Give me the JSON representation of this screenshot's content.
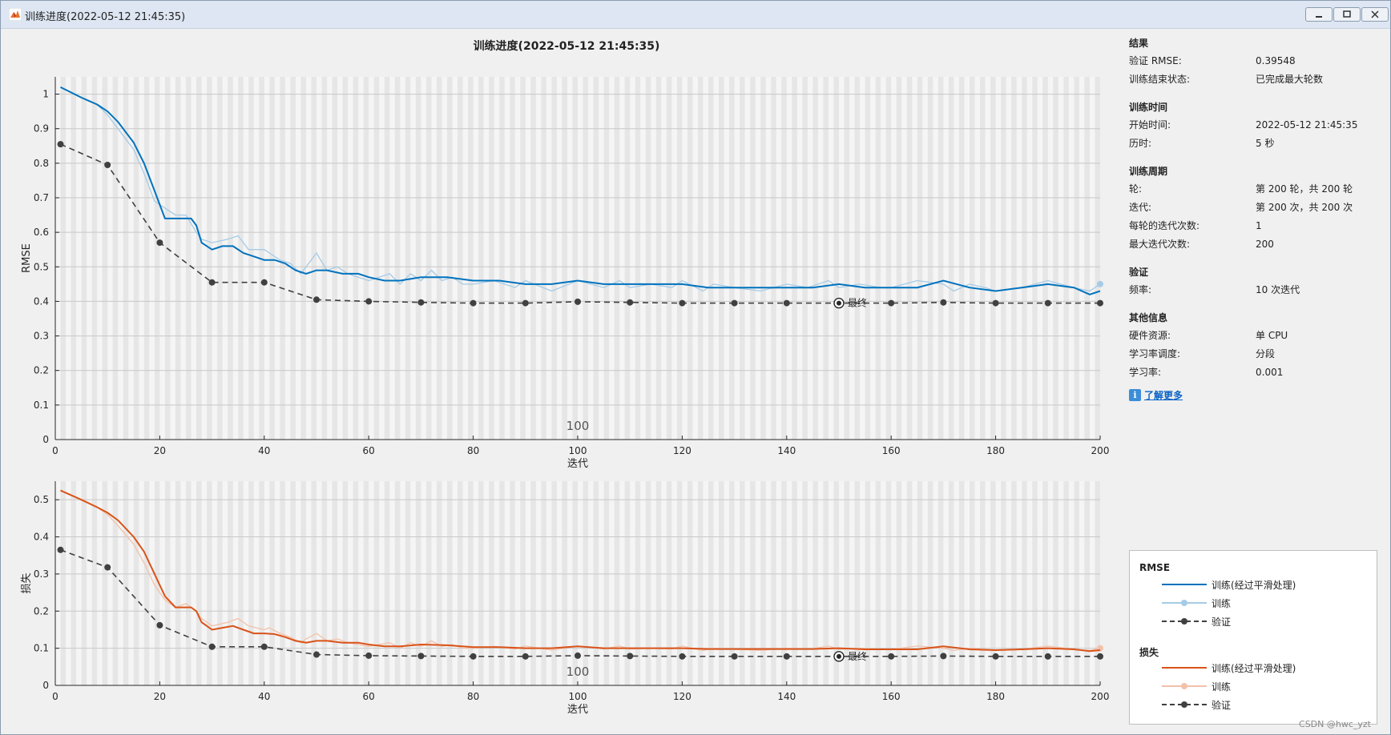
{
  "window": {
    "title": "训练进度(2022-05-12 21:45:35)"
  },
  "plot_title": "训练进度(2022-05-12 21:45:35)",
  "results": {
    "heading": "结果",
    "val_rmse_label": "验证 RMSE:",
    "val_rmse_value": "0.39548",
    "status_label": "训练结束状态:",
    "status_value": "已完成最大轮数"
  },
  "time": {
    "heading": "训练时间",
    "start_label": "开始时间:",
    "start_value": "2022-05-12 21:45:35",
    "elapsed_label": "历时:",
    "elapsed_value": "5 秒"
  },
  "cycle": {
    "heading": "训练周期",
    "epoch_label": "轮:",
    "epoch_value": "第 200 轮，共 200 轮",
    "iter_label": "迭代:",
    "iter_value": "第 200 次，共 200 次",
    "per_epoch_label": "每轮的迭代次数:",
    "per_epoch_value": "1",
    "max_iter_label": "最大迭代次数:",
    "max_iter_value": "200"
  },
  "validation": {
    "heading": "验证",
    "freq_label": "频率:",
    "freq_value": "10 次迭代"
  },
  "other": {
    "heading": "其他信息",
    "hw_label": "硬件资源:",
    "hw_value": "单 CPU",
    "lr_sched_label": "学习率调度:",
    "lr_sched_value": "分段",
    "lr_label": "学习率:",
    "lr_value": "0.001"
  },
  "learn_more": "了解更多",
  "legend": {
    "rmse_heading": "RMSE",
    "loss_heading": "损失",
    "smoothed": "训练(经过平滑处理)",
    "train": "训练",
    "val": "验证"
  },
  "watermark": "CSDN @hwc_yzt",
  "colors": {
    "rmse_smoothed": "#0072BD",
    "rmse_raw": "#A6CBE6",
    "loss_smoothed": "#D95319",
    "loss_raw": "#F3C1AA",
    "validation": "#404040"
  },
  "chart_data": [
    {
      "type": "line",
      "ylabel": "RMSE",
      "xlabel": "迭代",
      "xlim": [
        0,
        200
      ],
      "ylim": [
        0,
        1.05
      ],
      "xticks": [
        0,
        20,
        40,
        60,
        80,
        100,
        120,
        140,
        160,
        180,
        200
      ],
      "yticks": [
        0,
        0.1,
        0.2,
        0.3,
        0.4,
        0.5,
        0.6,
        0.7,
        0.8,
        0.9,
        1
      ],
      "epoch_marker_label": "100",
      "final_marker_label": "最终",
      "final_marker_x": 150,
      "series": [
        {
          "name": "训练(经过平滑处理)",
          "x": [
            1,
            5,
            8,
            10,
            12,
            15,
            17,
            19,
            21,
            23,
            26,
            27,
            28,
            30,
            32,
            34,
            36,
            38,
            40,
            42,
            44,
            46,
            48,
            50,
            52,
            55,
            58,
            60,
            63,
            66,
            70,
            75,
            80,
            85,
            90,
            95,
            100,
            105,
            110,
            115,
            120,
            125,
            130,
            135,
            140,
            145,
            150,
            155,
            160,
            165,
            170,
            175,
            180,
            185,
            190,
            195,
            198,
            200
          ],
          "y": [
            1.02,
            0.99,
            0.97,
            0.95,
            0.92,
            0.86,
            0.8,
            0.72,
            0.64,
            0.64,
            0.64,
            0.62,
            0.57,
            0.55,
            0.56,
            0.56,
            0.54,
            0.53,
            0.52,
            0.52,
            0.51,
            0.49,
            0.48,
            0.49,
            0.49,
            0.48,
            0.48,
            0.47,
            0.46,
            0.46,
            0.47,
            0.47,
            0.46,
            0.46,
            0.45,
            0.45,
            0.46,
            0.45,
            0.45,
            0.45,
            0.45,
            0.44,
            0.44,
            0.44,
            0.44,
            0.44,
            0.45,
            0.44,
            0.44,
            0.44,
            0.46,
            0.44,
            0.43,
            0.44,
            0.45,
            0.44,
            0.42,
            0.43
          ]
        },
        {
          "name": "训练",
          "x": [
            1,
            5,
            8,
            10,
            12,
            15,
            17,
            19,
            21,
            23,
            25,
            27,
            28,
            30,
            33,
            35,
            37,
            40,
            41,
            43,
            45,
            47,
            48,
            50,
            52,
            54,
            56,
            58,
            60,
            62,
            64,
            66,
            68,
            70,
            72,
            74,
            76,
            78,
            80,
            84,
            88,
            90,
            95,
            100,
            105,
            108,
            110,
            114,
            118,
            120,
            124,
            126,
            130,
            135,
            140,
            144,
            148,
            150,
            154,
            158,
            160,
            165,
            170,
            172,
            175,
            178,
            180,
            185,
            190,
            195,
            198,
            200
          ],
          "y": [
            1.02,
            0.99,
            0.97,
            0.94,
            0.9,
            0.84,
            0.77,
            0.69,
            0.67,
            0.65,
            0.65,
            0.6,
            0.58,
            0.57,
            0.58,
            0.59,
            0.55,
            0.55,
            0.54,
            0.52,
            0.51,
            0.48,
            0.5,
            0.54,
            0.49,
            0.5,
            0.48,
            0.47,
            0.46,
            0.47,
            0.48,
            0.45,
            0.48,
            0.46,
            0.49,
            0.46,
            0.47,
            0.45,
            0.45,
            0.46,
            0.44,
            0.46,
            0.43,
            0.46,
            0.44,
            0.46,
            0.44,
            0.45,
            0.44,
            0.46,
            0.43,
            0.45,
            0.44,
            0.43,
            0.45,
            0.44,
            0.46,
            0.44,
            0.45,
            0.44,
            0.44,
            0.46,
            0.45,
            0.43,
            0.45,
            0.44,
            0.43,
            0.44,
            0.46,
            0.44,
            0.43,
            0.45
          ]
        },
        {
          "name": "验证",
          "x": [
            1,
            10,
            20,
            30,
            40,
            50,
            60,
            70,
            80,
            90,
            100,
            110,
            120,
            130,
            140,
            150,
            160,
            170,
            180,
            190,
            200
          ],
          "y": [
            0.855,
            0.795,
            0.57,
            0.455,
            0.455,
            0.405,
            0.4,
            0.397,
            0.395,
            0.395,
            0.399,
            0.397,
            0.395,
            0.395,
            0.395,
            0.395,
            0.395,
            0.397,
            0.395,
            0.395,
            0.395
          ]
        }
      ]
    },
    {
      "type": "line",
      "ylabel": "损失",
      "xlabel": "迭代",
      "xlim": [
        0,
        200
      ],
      "ylim": [
        0,
        0.55
      ],
      "xticks": [
        0,
        20,
        40,
        60,
        80,
        100,
        120,
        140,
        160,
        180,
        200
      ],
      "yticks": [
        0,
        0.1,
        0.2,
        0.3,
        0.4,
        0.5
      ],
      "epoch_marker_label": "100",
      "final_marker_label": "最终",
      "final_marker_x": 150,
      "series": [
        {
          "name": "训练(经过平滑处理)",
          "x": [
            1,
            5,
            8,
            10,
            12,
            15,
            17,
            19,
            21,
            23,
            26,
            27,
            28,
            30,
            32,
            34,
            36,
            38,
            40,
            42,
            44,
            46,
            48,
            50,
            52,
            55,
            58,
            60,
            63,
            66,
            70,
            75,
            80,
            85,
            90,
            95,
            100,
            105,
            110,
            115,
            120,
            125,
            130,
            135,
            140,
            145,
            150,
            155,
            160,
            165,
            170,
            175,
            180,
            185,
            190,
            195,
            198,
            200
          ],
          "y": [
            0.525,
            0.5,
            0.48,
            0.465,
            0.445,
            0.4,
            0.36,
            0.3,
            0.24,
            0.21,
            0.21,
            0.2,
            0.17,
            0.15,
            0.155,
            0.16,
            0.15,
            0.14,
            0.14,
            0.138,
            0.13,
            0.12,
            0.115,
            0.12,
            0.12,
            0.115,
            0.115,
            0.11,
            0.105,
            0.105,
            0.11,
            0.108,
            0.103,
            0.103,
            0.1,
            0.1,
            0.105,
            0.1,
            0.1,
            0.1,
            0.1,
            0.098,
            0.098,
            0.098,
            0.098,
            0.098,
            0.1,
            0.097,
            0.097,
            0.097,
            0.105,
            0.097,
            0.095,
            0.097,
            0.1,
            0.097,
            0.092,
            0.095
          ]
        },
        {
          "name": "训练",
          "x": [
            1,
            5,
            8,
            10,
            12,
            15,
            17,
            19,
            21,
            23,
            25,
            27,
            28,
            30,
            33,
            35,
            37,
            40,
            41,
            43,
            45,
            47,
            48,
            50,
            52,
            54,
            56,
            58,
            60,
            62,
            64,
            66,
            68,
            70,
            72,
            74,
            76,
            78,
            80,
            84,
            88,
            90,
            95,
            100,
            105,
            108,
            110,
            114,
            118,
            120,
            124,
            126,
            130,
            135,
            140,
            144,
            148,
            150,
            154,
            158,
            160,
            165,
            170,
            172,
            175,
            178,
            180,
            185,
            190,
            195,
            198,
            200
          ],
          "y": [
            0.525,
            0.5,
            0.48,
            0.46,
            0.43,
            0.38,
            0.33,
            0.27,
            0.23,
            0.21,
            0.22,
            0.2,
            0.18,
            0.16,
            0.17,
            0.18,
            0.16,
            0.15,
            0.155,
            0.14,
            0.13,
            0.115,
            0.125,
            0.14,
            0.12,
            0.125,
            0.115,
            0.11,
            0.105,
            0.11,
            0.115,
            0.1,
            0.115,
            0.105,
            0.12,
            0.105,
            0.11,
            0.1,
            0.1,
            0.105,
            0.098,
            0.106,
            0.095,
            0.106,
            0.098,
            0.106,
            0.098,
            0.1,
            0.098,
            0.106,
            0.094,
            0.1,
            0.097,
            0.094,
            0.1,
            0.097,
            0.106,
            0.097,
            0.1,
            0.097,
            0.097,
            0.106,
            0.1,
            0.094,
            0.1,
            0.097,
            0.094,
            0.097,
            0.106,
            0.097,
            0.094,
            0.1
          ]
        },
        {
          "name": "验证",
          "x": [
            1,
            10,
            20,
            30,
            40,
            50,
            60,
            70,
            80,
            90,
            100,
            110,
            120,
            130,
            140,
            150,
            160,
            170,
            180,
            190,
            200
          ],
          "y": [
            0.365,
            0.318,
            0.162,
            0.104,
            0.104,
            0.083,
            0.08,
            0.079,
            0.078,
            0.078,
            0.08,
            0.079,
            0.078,
            0.078,
            0.078,
            0.078,
            0.078,
            0.079,
            0.078,
            0.078,
            0.078
          ]
        }
      ]
    }
  ]
}
